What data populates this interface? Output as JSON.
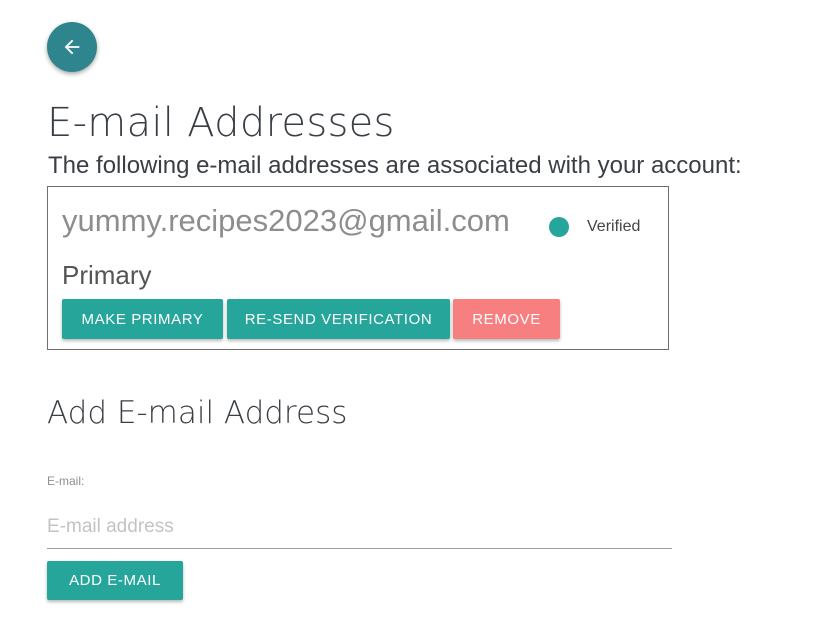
{
  "header": {
    "back_icon": "arrow-left-icon",
    "title": "E-mail Addresses",
    "subtitle": "The following e-mail addresses are associated with your account:"
  },
  "emails": [
    {
      "address": "yummy.recipes2023@gmail.com",
      "status": "Verified",
      "status_color": "#26a69a",
      "primary_label": "Primary",
      "actions": {
        "make_primary": "MAKE PRIMARY",
        "resend_verification": "RE-SEND VERIFICATION",
        "remove": "REMOVE"
      }
    }
  ],
  "add_section": {
    "heading": "Add E-mail Address",
    "field_label": "E-mail:",
    "input_value": "",
    "input_placeholder": "E-mail address",
    "submit_label": "ADD E-MAIL"
  },
  "colors": {
    "primary": "#26a69a",
    "back_button": "#2f858e",
    "danger": "#f77f7f",
    "text": "#3a3e45"
  }
}
